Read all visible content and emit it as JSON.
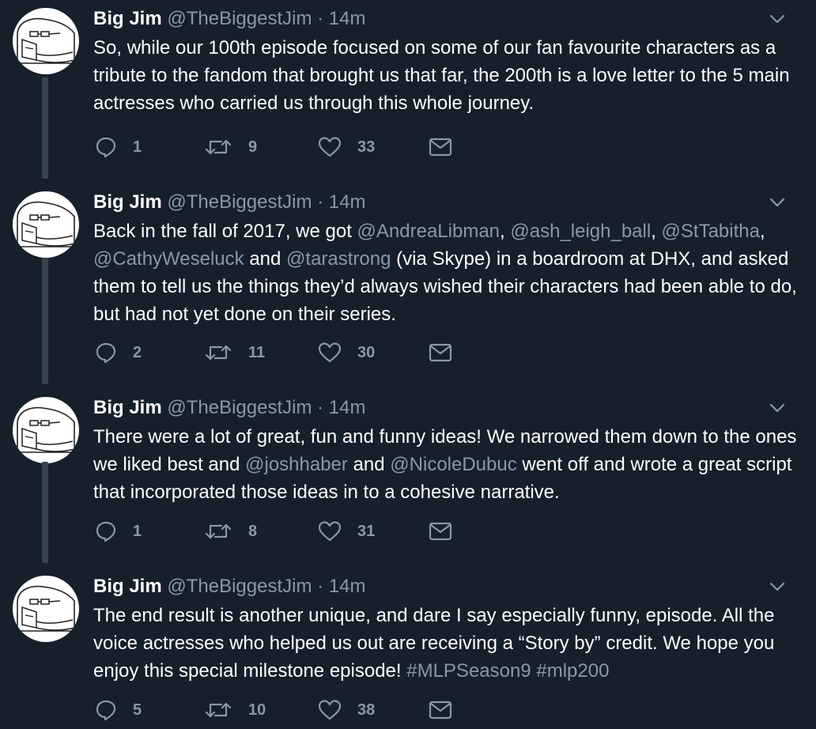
{
  "colors": {
    "background": "#15202b",
    "text": "#ffffff",
    "muted": "#8899a6",
    "thread_line": "#38444d"
  },
  "tweets": [
    {
      "name": "Big Jim",
      "handle": "@TheBiggestJim",
      "separator": "·",
      "time": "14m",
      "text": [
        {
          "t": "So, while our 100th episode focused on some of our fan favourite characters as a tribute to the fandom that brought us that far, the 200th is a love letter to the 5 main actresses who carried us through this whole journey."
        }
      ],
      "replies": "1",
      "retweets": "9",
      "likes": "33",
      "icons": [
        "reply-icon",
        "retweet-icon",
        "like-icon",
        "message-icon",
        "chevron-down-icon"
      ]
    },
    {
      "name": "Big Jim",
      "handle": "@TheBiggestJim",
      "separator": "·",
      "time": "14m",
      "text": [
        {
          "t": "Back in the fall of 2017, we got "
        },
        {
          "t": "@AndreaLibman",
          "type": "mention"
        },
        {
          "t": ", "
        },
        {
          "t": "@ash_leigh_ball",
          "type": "mention"
        },
        {
          "t": ", "
        },
        {
          "t": "@StTabitha",
          "type": "mention"
        },
        {
          "t": ", "
        },
        {
          "t": "@CathyWeseluck",
          "type": "mention"
        },
        {
          "t": " and "
        },
        {
          "t": "@tarastrong",
          "type": "mention"
        },
        {
          "t": " (via Skype) in a boardroom at DHX, and asked them to tell us the things they’d always wished their characters had been able to do, but had not yet done on their series."
        }
      ],
      "replies": "2",
      "retweets": "11",
      "likes": "30"
    },
    {
      "name": "Big Jim",
      "handle": "@TheBiggestJim",
      "separator": "·",
      "time": "14m",
      "text": [
        {
          "t": "There were a lot of great, fun and funny ideas! We narrowed them down to the ones we liked best and "
        },
        {
          "t": "@joshhaber",
          "type": "mention"
        },
        {
          "t": " and "
        },
        {
          "t": "@NicoleDubuc",
          "type": "mention"
        },
        {
          "t": " went off and wrote a great script that incorporated those ideas in to a cohesive narrative."
        }
      ],
      "replies": "1",
      "retweets": "8",
      "likes": "31"
    },
    {
      "name": "Big Jim",
      "handle": "@TheBiggestJim",
      "separator": "·",
      "time": "14m",
      "text": [
        {
          "t": "The end result is another unique, and dare I say especially funny, episode. All the voice actresses who helped us out are receiving a “Story by” credit. We hope you enjoy this special milestone episode! "
        },
        {
          "t": "#MLPSeason9",
          "type": "hashtag"
        },
        {
          "t": " "
        },
        {
          "t": "#mlp200",
          "type": "hashtag"
        }
      ],
      "replies": "5",
      "retweets": "10",
      "likes": "38"
    }
  ]
}
